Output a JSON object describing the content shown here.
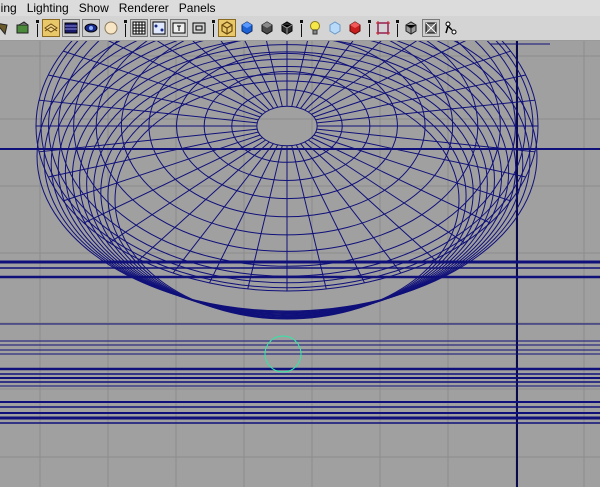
{
  "menubar": {
    "items": [
      {
        "label": "ling"
      },
      {
        "label": "Lighting"
      },
      {
        "label": "Show"
      },
      {
        "label": "Renderer"
      },
      {
        "label": "Panels"
      }
    ]
  },
  "toolbar": {
    "buttons": [
      {
        "icon": "select-camera-icon"
      },
      {
        "icon": "lock-camera-icon"
      },
      {
        "icon": "camera-attributes-icon"
      },
      {
        "icon": "bookmarks-icon"
      },
      {
        "icon": "image-plane-icon"
      },
      {
        "icon": "2d-pan-zoom-icon"
      },
      {
        "icon": "grease-pencil-icon"
      },
      {
        "icon": "grid-icon"
      },
      {
        "icon": "film-gate-icon"
      },
      {
        "icon": "resolution-gate-icon"
      },
      {
        "icon": "safe-title-icon"
      },
      {
        "icon": "wireframe-icon"
      },
      {
        "icon": "smooth-shade-icon"
      },
      {
        "icon": "use-default-material-icon"
      },
      {
        "icon": "wireframe-on-shaded-icon"
      },
      {
        "icon": "textured-icon"
      },
      {
        "icon": "use-all-lights-icon"
      },
      {
        "icon": "shadows-icon"
      },
      {
        "icon": "screen-space-ao-icon"
      },
      {
        "icon": "isolate-select-icon"
      },
      {
        "icon": "xray-icon"
      },
      {
        "icon": "xray-active-components-icon"
      },
      {
        "icon": "xray-joints-icon"
      }
    ]
  },
  "viewport": {
    "background": "#a0a0a0",
    "grid_color": "#8c8c8c",
    "wire_color": "#10107a",
    "cursor_color": "#2fe8a8"
  }
}
